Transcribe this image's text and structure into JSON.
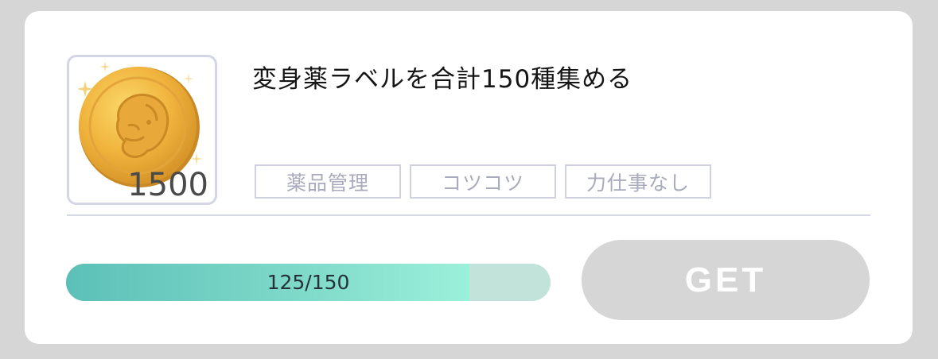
{
  "reward": {
    "icon": "gold-coin-icon",
    "amount": "1500"
  },
  "mission": {
    "title": "変身薬ラベルを合計150種集める",
    "tags": [
      "薬品管理",
      "コツコツ",
      "力仕事なし"
    ]
  },
  "progress": {
    "current": 125,
    "total": 150,
    "fraction": 0.833,
    "label": "125/150"
  },
  "action": {
    "get_label": "GET",
    "state": "disabled"
  },
  "colors": {
    "background": "#d6d6d6",
    "card": "#ffffff",
    "progress_fill": "#5cc0b8",
    "progress_track": "#c2e3d9",
    "button": "#d6d6d6",
    "tag_border": "#cfd1e1"
  }
}
